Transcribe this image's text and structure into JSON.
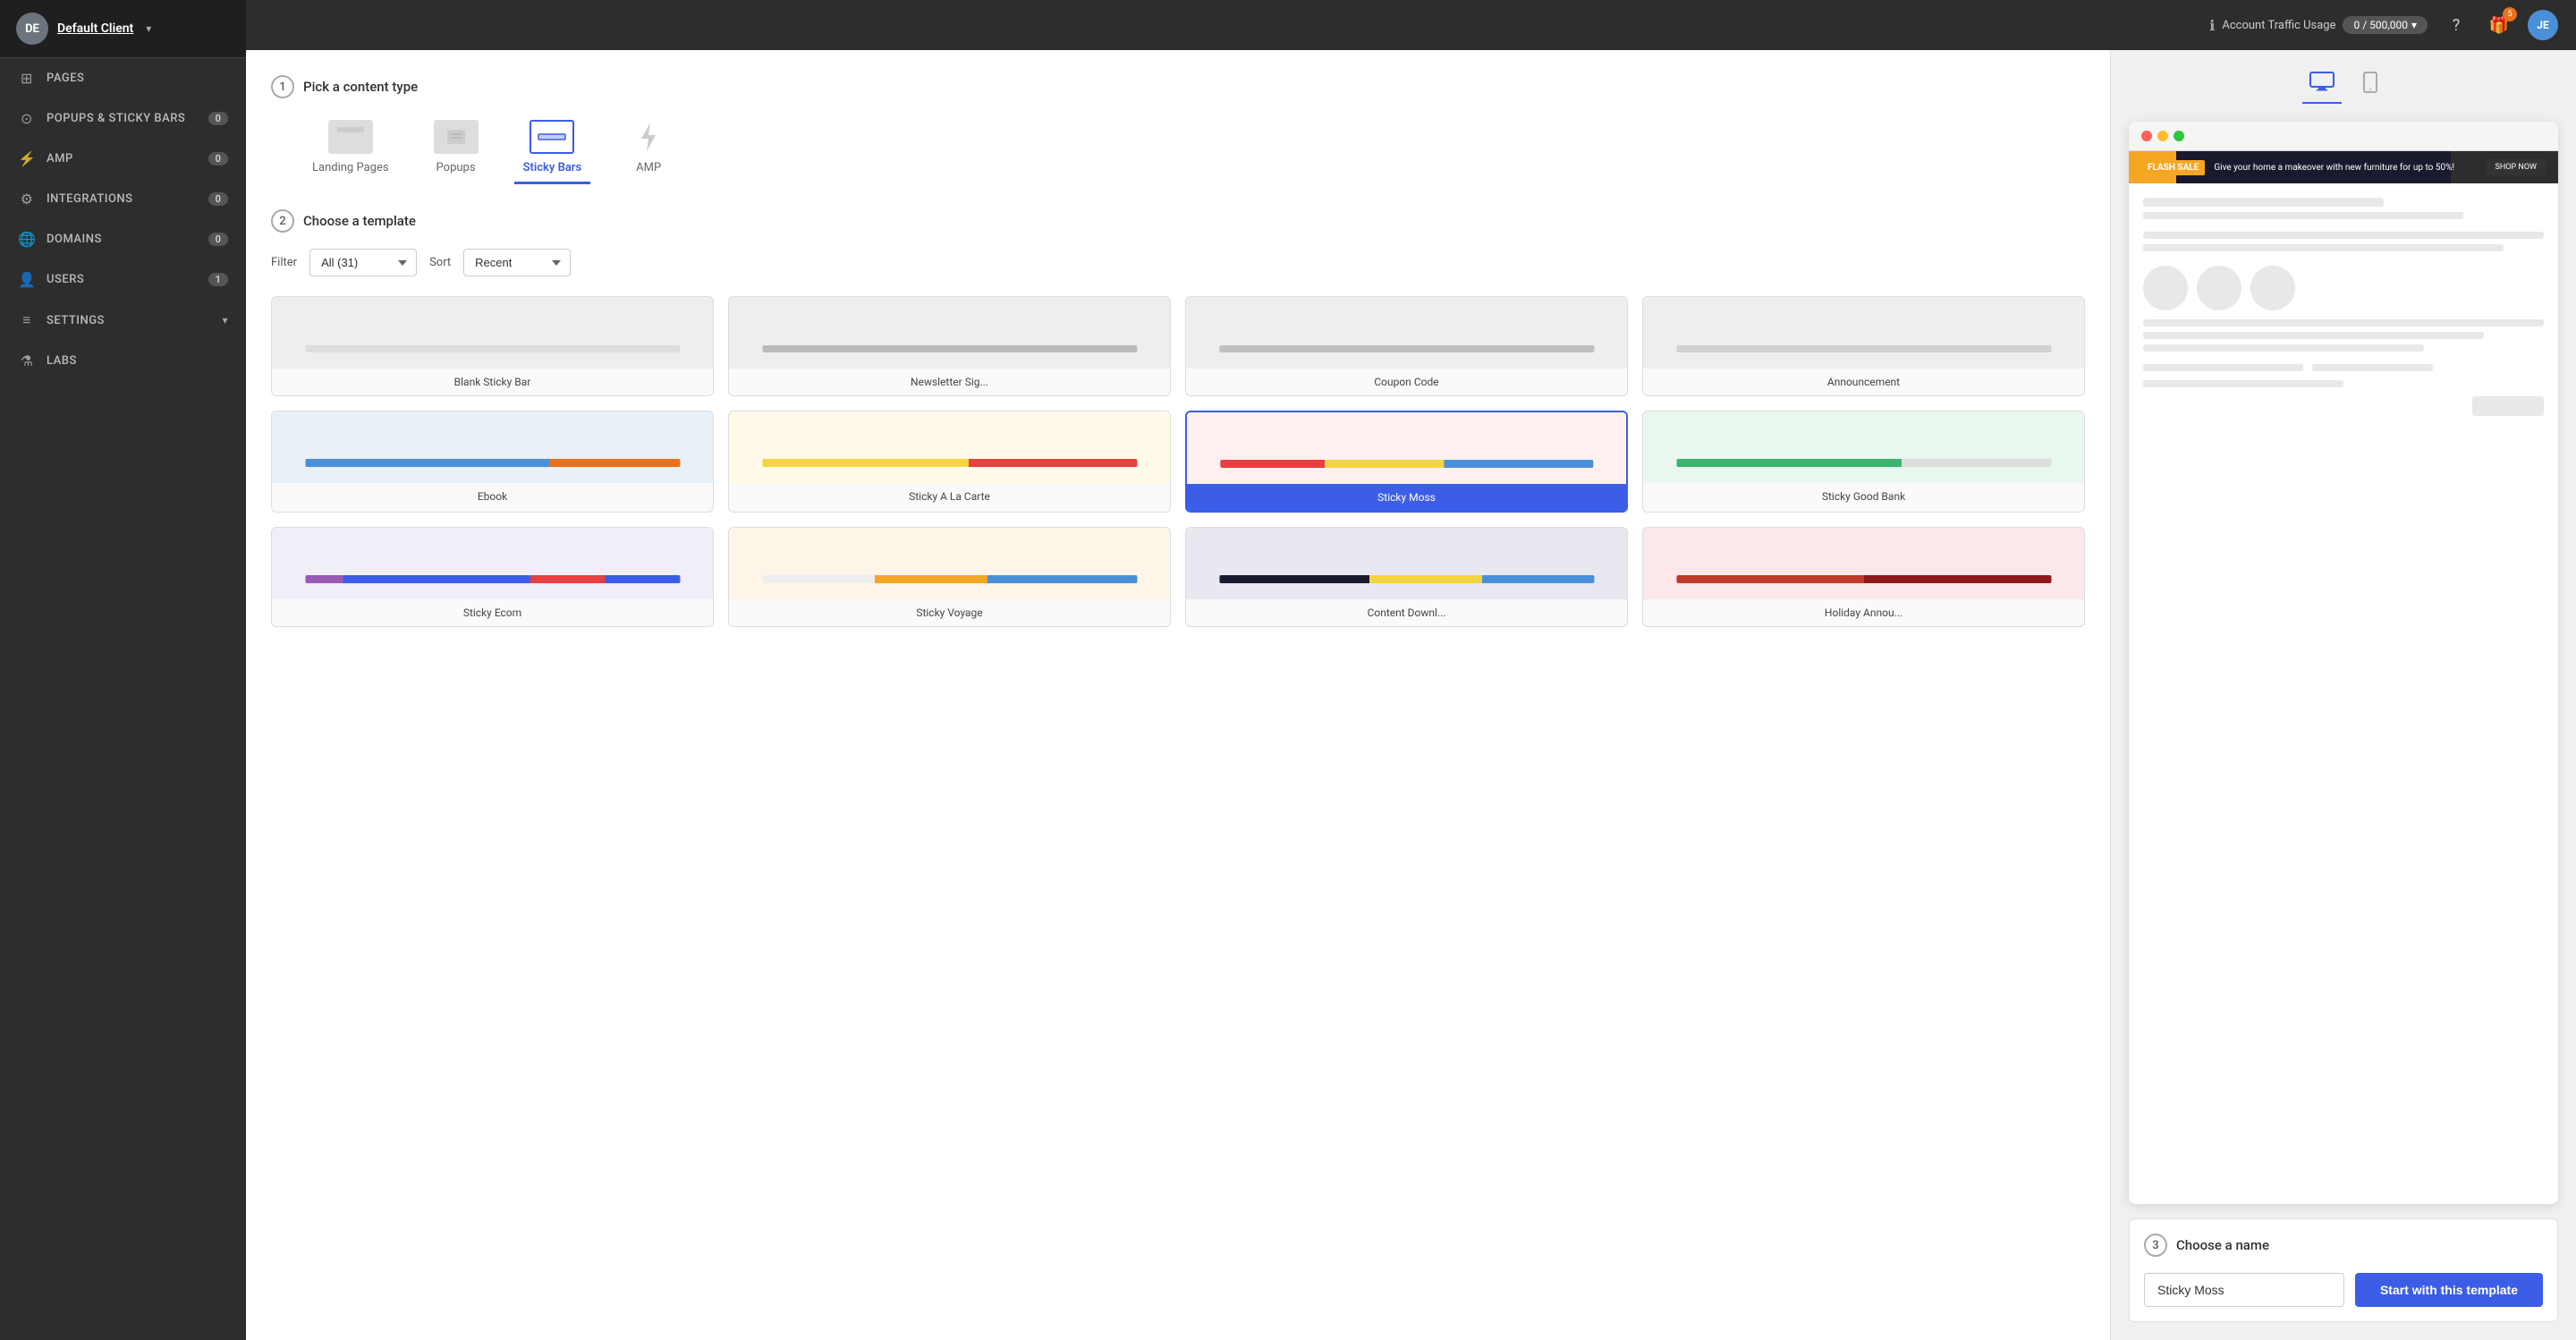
{
  "sidebar": {
    "client_initials": "DE",
    "client_name": "Default Client",
    "nav_items": [
      {
        "id": "pages",
        "label": "PAGES",
        "icon": "☰",
        "badge": null
      },
      {
        "id": "popups",
        "label": "POPUPS & STICKY BARS",
        "icon": "◎",
        "badge": "0"
      },
      {
        "id": "amp",
        "label": "AMP",
        "icon": "⚡",
        "badge": "0"
      },
      {
        "id": "integrations",
        "label": "INTEGRATIONS",
        "icon": "⚙",
        "badge": "0"
      },
      {
        "id": "domains",
        "label": "DOMAINS",
        "icon": "🌐",
        "badge": "0"
      },
      {
        "id": "users",
        "label": "USERS",
        "icon": "👤",
        "badge": "1"
      },
      {
        "id": "settings",
        "label": "SETTINGS",
        "icon": "≡",
        "badge": null,
        "has_arrow": true
      },
      {
        "id": "labs",
        "label": "LABS",
        "icon": "⚗",
        "badge": null
      }
    ]
  },
  "topbar": {
    "traffic_label": "Account Traffic Usage",
    "traffic_value": "0 / 500,000",
    "user_initials": "JE",
    "notification_count": "5"
  },
  "step1": {
    "number": "1",
    "label": "Pick a content type",
    "types": [
      {
        "id": "landing-pages",
        "label": "Landing Pages",
        "active": false
      },
      {
        "id": "popups",
        "label": "Popups",
        "active": false
      },
      {
        "id": "sticky-bars",
        "label": "Sticky Bars",
        "active": true
      },
      {
        "id": "amp",
        "label": "AMP",
        "active": false
      }
    ]
  },
  "step2": {
    "number": "2",
    "label": "Choose a template",
    "filter_label": "Filter",
    "filter_value": "All (31)",
    "sort_label": "Sort",
    "sort_value": "Recent",
    "templates": [
      {
        "id": "blank-sticky-bar",
        "label": "Blank Sticky Bar",
        "thumb_type": "blank",
        "selected": false
      },
      {
        "id": "newsletter-sig",
        "label": "Newsletter Sig...",
        "thumb_type": "newsletter",
        "selected": false
      },
      {
        "id": "coupon-code",
        "label": "Coupon Code",
        "thumb_type": "coupon",
        "selected": false
      },
      {
        "id": "announcement",
        "label": "Announcement",
        "thumb_type": "announcement",
        "selected": false
      },
      {
        "id": "ebook",
        "label": "Ebook",
        "thumb_type": "ebook",
        "selected": false
      },
      {
        "id": "sticky-a-la-carte",
        "label": "Sticky A La Carte",
        "thumb_type": "sticky-a-la-carte",
        "selected": false
      },
      {
        "id": "sticky-moss",
        "label": "Sticky Moss",
        "thumb_type": "sticky-moss",
        "selected": true
      },
      {
        "id": "sticky-good-bank",
        "label": "Sticky Good Bank",
        "thumb_type": "sticky-good-bank",
        "selected": false
      },
      {
        "id": "sticky-ecom",
        "label": "Sticky Ecom",
        "thumb_type": "sticky-ecom",
        "selected": false
      },
      {
        "id": "sticky-voyage",
        "label": "Sticky Voyage",
        "thumb_type": "sticky-voyage",
        "selected": false
      },
      {
        "id": "content-downl",
        "label": "Content Downl...",
        "thumb_type": "content-downl",
        "selected": false
      },
      {
        "id": "holiday-annou",
        "label": "Holiday Annou...",
        "thumb_type": "holiday",
        "selected": false
      }
    ]
  },
  "preview": {
    "device_desktop_label": "desktop",
    "device_mobile_label": "mobile",
    "sticky_bar": {
      "flash_sale": "FLASH SALE",
      "text": "Give your home a makeover with new furniture for up to 50%!",
      "cta": "SHOP NOW"
    }
  },
  "step3": {
    "number": "3",
    "label": "Choose a name",
    "name_value": "Sticky Moss",
    "name_placeholder": "Sticky Moss",
    "cta_label": "Start with this template"
  }
}
